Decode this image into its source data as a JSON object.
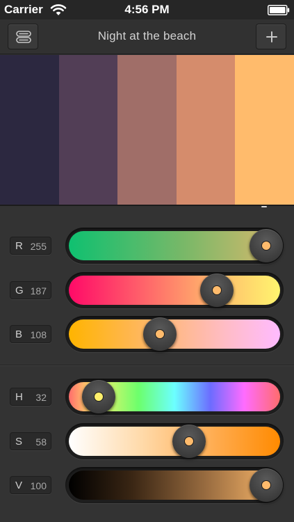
{
  "status": {
    "carrier": "Carrier",
    "time": "4:56 PM"
  },
  "nav": {
    "title": "Night at the beach",
    "add_label": "+"
  },
  "palette": {
    "swatches": [
      "#2c2840",
      "#523e56",
      "#a06e68",
      "#d58c6c",
      "#ffbb6c"
    ],
    "selected_index": 4
  },
  "sliders": [
    {
      "key": "r",
      "letter": "R",
      "value": "255",
      "fraction": 1.0,
      "fill": "linear-gradient(90deg,#0fc070 0%,#7ab868 55%,#d8b86c 100%)",
      "dot": "#ffbb6c"
    },
    {
      "key": "g",
      "letter": "G",
      "value": "187",
      "fraction": 0.733,
      "fill": "linear-gradient(90deg,#ff0a68 0%,#ff6f6a 40%,#ffbb6c 70%,#fff56e 100%)",
      "dot": "#ffbb6c"
    },
    {
      "key": "b",
      "letter": "B",
      "value": "108",
      "fraction": 0.424,
      "fill": "linear-gradient(90deg,#ffb400 0%,#ffb87a 45%,#ffbcc8 75%,#ffbbff 100%)",
      "dot": "#ffbb6c"
    },
    {
      "key": "h",
      "letter": "H",
      "value": "32",
      "fraction": 0.089,
      "fill": "linear-gradient(90deg,#ff6c6c 0%,#fff06c 12%,#6cff6c 33%,#6cffff 50%,#6c6cff 67%,#ff6cff 83%,#ff6c6c 100%)",
      "dot": "#fff06c"
    },
    {
      "key": "s",
      "letter": "S",
      "value": "58",
      "fraction": 0.58,
      "fill": "linear-gradient(90deg,#ffffff 0%,#ffd9a8 35%,#ffab4e 70%,#ff8a00 100%)",
      "dot": "#ffbb6c"
    },
    {
      "key": "v",
      "letter": "V",
      "value": "100",
      "fraction": 1.0,
      "fill": "linear-gradient(90deg,#000000 0%,#3a2614 30%,#996c40 65%,#ffbb6c 100%)",
      "dot": "#ffbb6c"
    }
  ]
}
